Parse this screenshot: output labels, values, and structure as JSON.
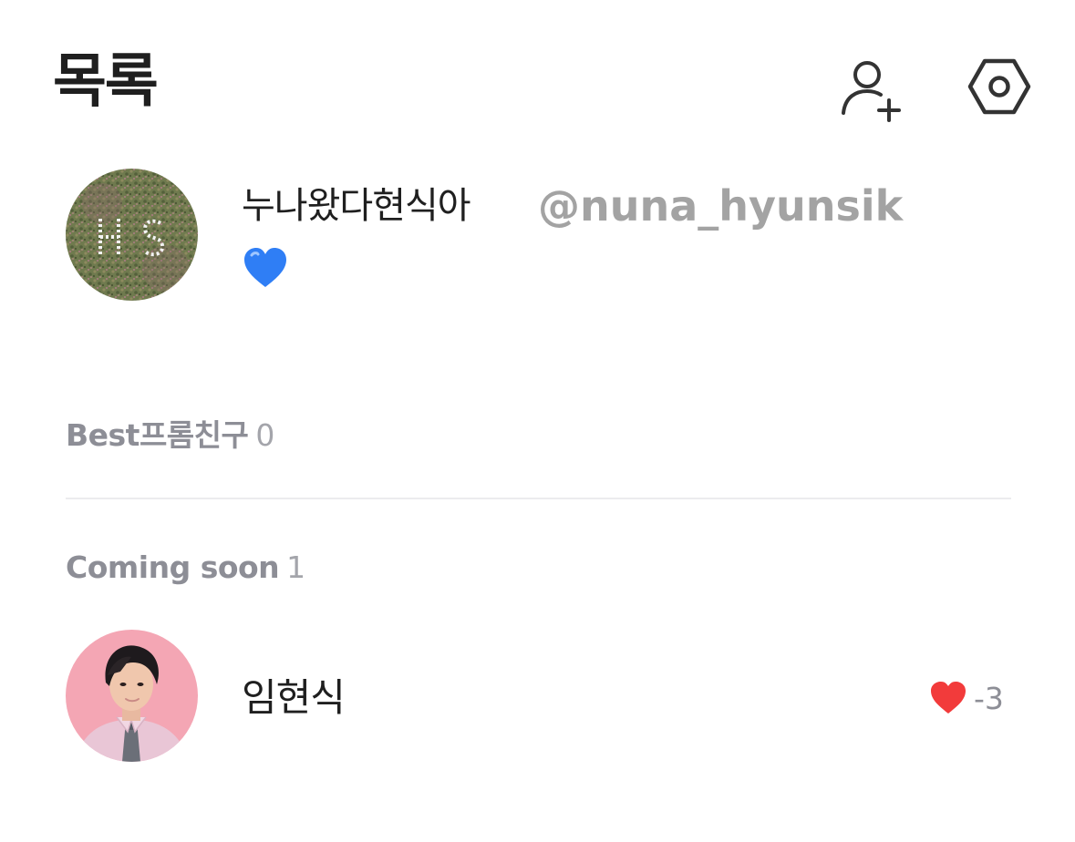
{
  "header": {
    "title": "목록",
    "add_friend_icon": "person-add-icon",
    "settings_icon": "hexagon-settings-icon"
  },
  "profile": {
    "name": "누나왔다현식아",
    "status_icon": "blue-heart-icon",
    "status_color": "#2f7ef5",
    "watermark": "@nuna_hyunsik"
  },
  "sections": {
    "best": {
      "label": "Best프롬친구",
      "count": "0"
    },
    "coming_soon": {
      "label": "Coming soon",
      "count": "1"
    }
  },
  "friends": [
    {
      "name": "임현식",
      "heart_icon": "red-heart-icon",
      "heart_color": "#f23b3b",
      "score": "-3"
    }
  ],
  "colors": {
    "accent_red": "#f23b3b",
    "section_gray": "#8d8e96",
    "text_dark": "#1f1f1f"
  }
}
